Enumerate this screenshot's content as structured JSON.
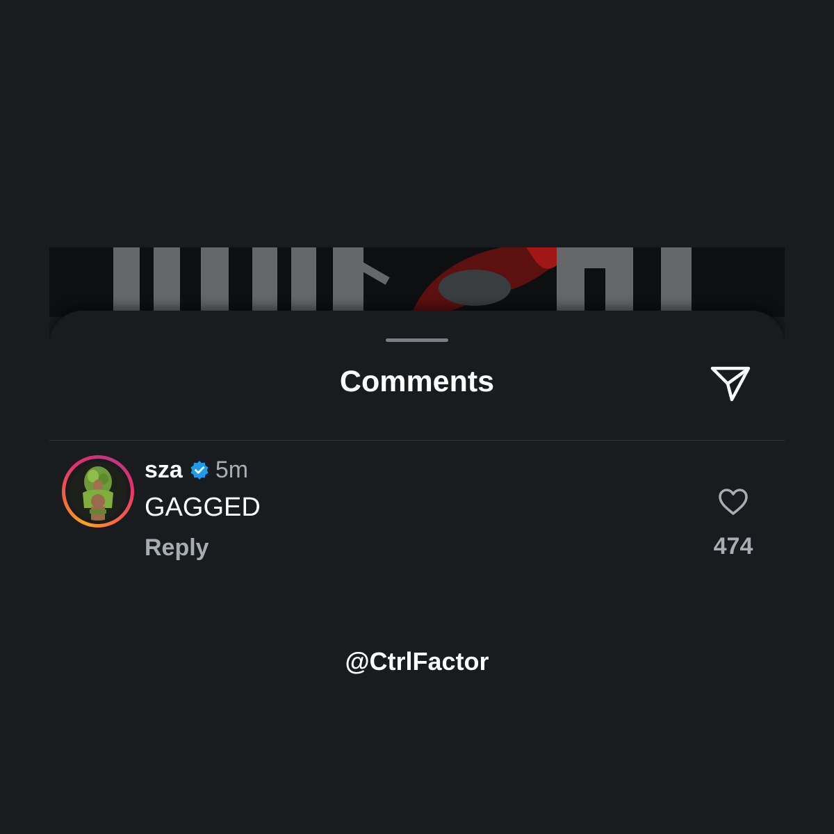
{
  "sheet": {
    "title": "Comments",
    "share_icon": "send-icon"
  },
  "comment": {
    "username": "sza",
    "verified_icon": "verified-badge-icon",
    "time": "5m",
    "text": "GAGGED",
    "reply_label": "Reply",
    "like_icon": "heart-icon",
    "like_count": "474",
    "avatar_ring_colors": [
      "#f9a51a",
      "#e1306c",
      "#c13584"
    ]
  },
  "watermark": "@CtrlFactor",
  "colors": {
    "background": "#181c1f",
    "text_primary": "#ffffff",
    "text_secondary": "#a8adb3",
    "verified_blue": "#1d9bf0",
    "divider": "#30353a"
  }
}
